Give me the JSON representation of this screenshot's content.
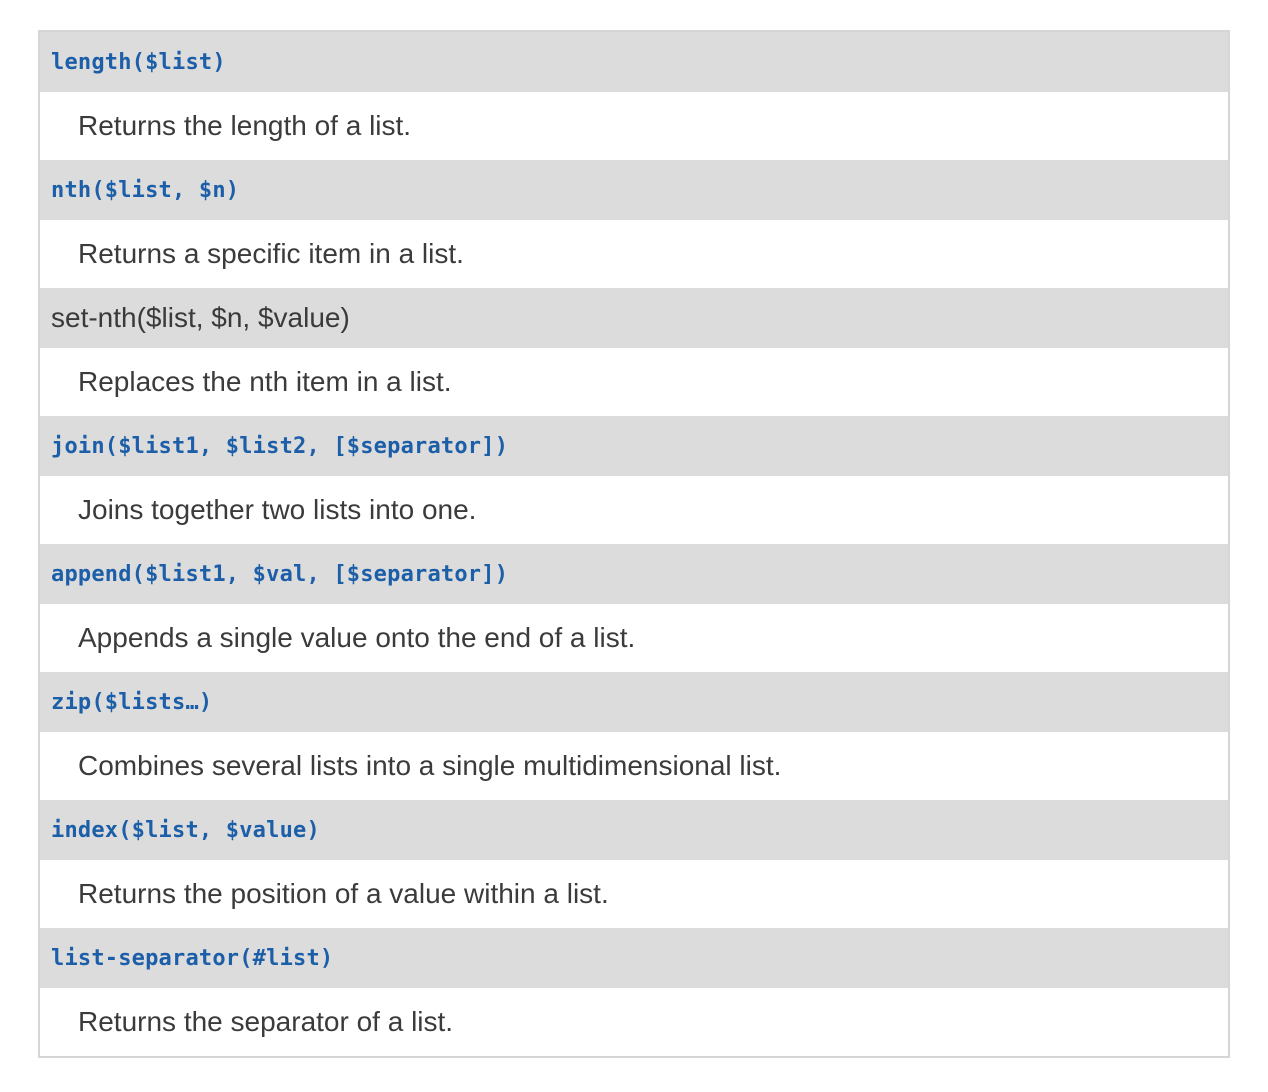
{
  "functions": [
    {
      "signature": "length($list)",
      "description": "Returns the length of a list.",
      "style": "code"
    },
    {
      "signature": "nth($list, $n)",
      "description": "Returns a specific item in a list.",
      "style": "code"
    },
    {
      "signature": "set-nth($list, $n, $value)",
      "description": "Replaces the nth item in a list.",
      "style": "plain"
    },
    {
      "signature": "join($list1, $list2, [$separator])",
      "description": "Joins together two lists into one.",
      "style": "code"
    },
    {
      "signature": "append($list1, $val, [$separator])",
      "description": "Appends a single value onto the end of a list.",
      "style": "code"
    },
    {
      "signature": "zip($lists…)",
      "description": "Combines several lists into a single multidimensional list.",
      "style": "code"
    },
    {
      "signature": "index($list, $value)",
      "description": "Returns the position of a value within a list.",
      "style": "code"
    },
    {
      "signature": "list-separator(#list)",
      "description": "Returns the separator of a list.",
      "style": "code"
    }
  ],
  "colors": {
    "header_bg": "#dcdcdc",
    "code_text": "#1c5fa8",
    "body_text": "#3b3b3b",
    "border": "#d6d6d6"
  }
}
